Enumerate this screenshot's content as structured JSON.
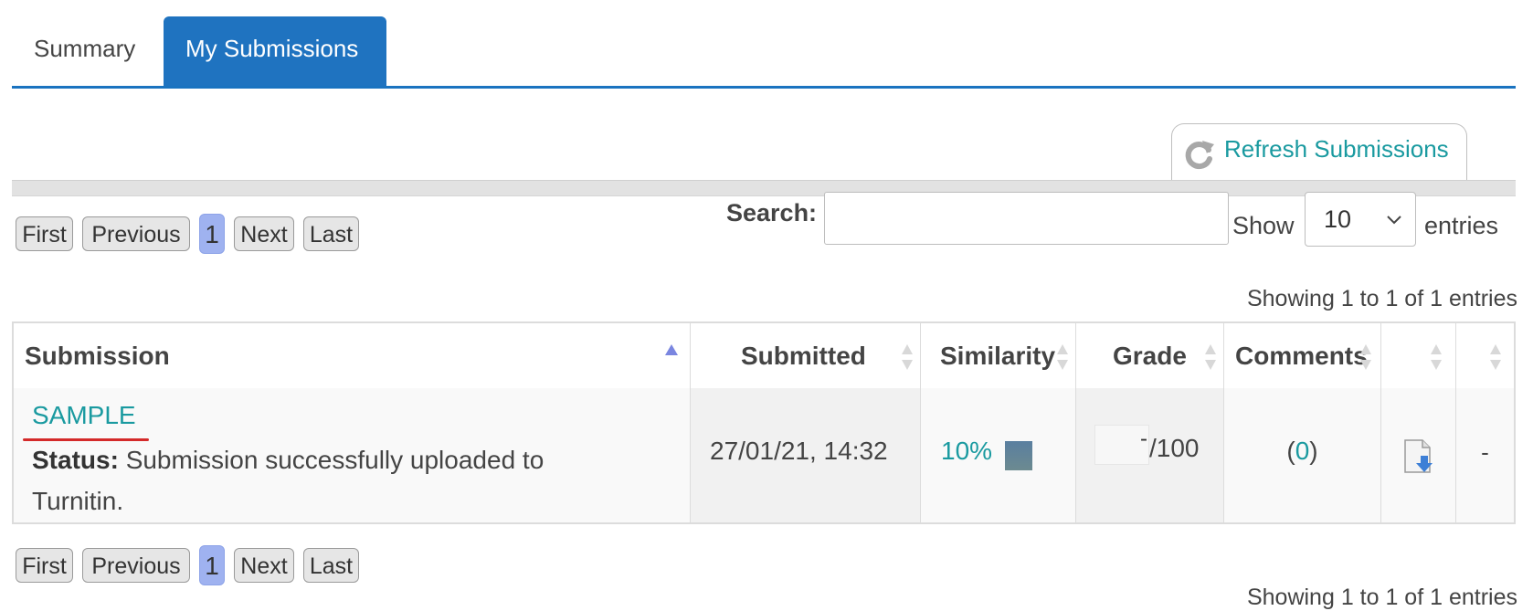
{
  "tabs": [
    {
      "label": "Summary",
      "active": false
    },
    {
      "label": "My Submissions",
      "active": true
    }
  ],
  "refresh": {
    "label": "Refresh Submissions",
    "icon": "refresh-icon"
  },
  "pagination": {
    "first": "First",
    "previous": "Previous",
    "current": "1",
    "next": "Next",
    "last": "Last"
  },
  "search": {
    "label": "Search:",
    "value": "",
    "placeholder": ""
  },
  "show": {
    "label": "Show",
    "value": "10",
    "suffix": "entries"
  },
  "info": "Showing 1 to 1 of 1 entries",
  "table": {
    "columns": [
      "Submission",
      "Submitted",
      "Similarity",
      "Grade",
      "Comments",
      "",
      ""
    ],
    "rows": [
      {
        "title": "SAMPLE",
        "status_label": "Status:",
        "status_text": "Submission successfully uploaded to Turnitin.",
        "submitted": "27/01/21, 14:32",
        "similarity": "10%",
        "grade_value": "-",
        "grade_max": "/100",
        "comments_open": "(",
        "comments_count": "0",
        "comments_close": ")",
        "download_icon": "download-document-icon",
        "last_col": "-"
      }
    ]
  },
  "colors": {
    "accent": "#1f73c0",
    "link": "#1a9aa0",
    "pager_current": "#9fb2f0",
    "annotation_underline": "#d42a2a"
  }
}
